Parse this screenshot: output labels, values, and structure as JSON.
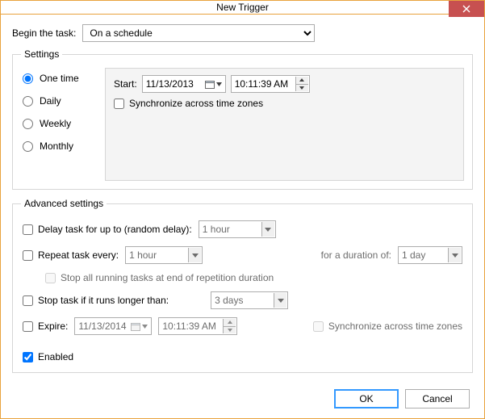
{
  "window": {
    "title": "New Trigger"
  },
  "begin": {
    "label": "Begin the task:",
    "selected": "On a schedule"
  },
  "settings": {
    "legend": "Settings",
    "recurrence": {
      "one_time": "One time",
      "daily": "Daily",
      "weekly": "Weekly",
      "monthly": "Monthly",
      "selected": "one_time"
    },
    "start_label": "Start:",
    "start_date": "11/13/2013",
    "start_time": "10:11:39 AM",
    "sync_tz_label": "Synchronize across time zones",
    "sync_tz_checked": false
  },
  "advanced": {
    "legend": "Advanced settings",
    "delay": {
      "label": "Delay task for up to (random delay):",
      "checked": false,
      "value": "1 hour"
    },
    "repeat": {
      "label": "Repeat task every:",
      "checked": false,
      "value": "1 hour",
      "duration_label": "for a duration of:",
      "duration_value": "1 day"
    },
    "stop_all": {
      "label": "Stop all running tasks at end of repetition duration",
      "checked": false
    },
    "stop_if": {
      "label": "Stop task if it runs longer than:",
      "checked": false,
      "value": "3 days"
    },
    "expire": {
      "label": "Expire:",
      "checked": false,
      "date": "11/13/2014",
      "time": "10:11:39 AM",
      "sync_tz_label": "Synchronize across time zones",
      "sync_tz_checked": false
    },
    "enabled": {
      "label": "Enabled",
      "checked": true
    }
  },
  "buttons": {
    "ok": "OK",
    "cancel": "Cancel"
  }
}
